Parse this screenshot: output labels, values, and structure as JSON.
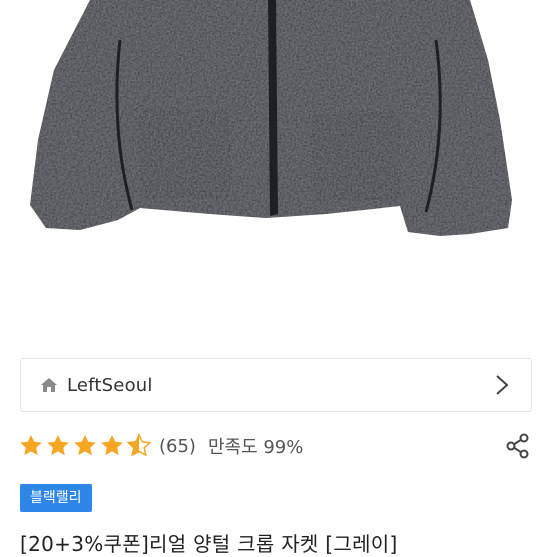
{
  "store": {
    "name": "LeftSeoul"
  },
  "rating": {
    "stars": 4.5,
    "review_count": "(65)",
    "satisfaction": "만족도 99%",
    "star_color": "#f5a623"
  },
  "badge": {
    "label": "블랙랠리",
    "color": "#2f86e9"
  },
  "product": {
    "title": "[20+3%쿠폰]리얼 양털 크롭 자켓 [그레이]",
    "image_icon": "fleece-jacket-image"
  }
}
